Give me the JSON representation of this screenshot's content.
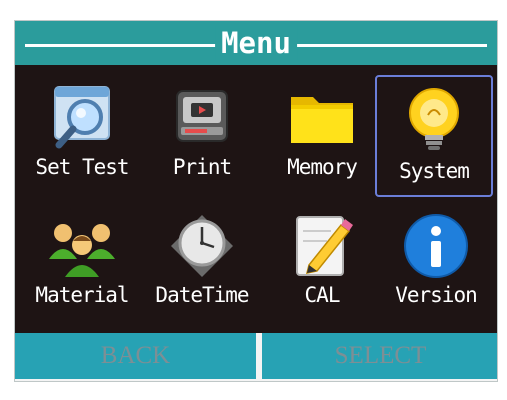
{
  "title": "Menu",
  "menu": {
    "items": [
      {
        "label": "Set Test",
        "icon": "magnifier-icon"
      },
      {
        "label": "Print",
        "icon": "printer-icon"
      },
      {
        "label": "Memory",
        "icon": "folder-icon"
      },
      {
        "label": "System",
        "icon": "lightbulb-icon",
        "selected": true
      },
      {
        "label": "Material",
        "icon": "users-icon"
      },
      {
        "label": "DateTime",
        "icon": "clock-icon"
      },
      {
        "label": "CAL",
        "icon": "pencil-note-icon"
      },
      {
        "label": "Version",
        "icon": "info-icon"
      }
    ]
  },
  "footer": {
    "back_label": "BACK",
    "select_label": "SELECT"
  },
  "colors": {
    "title_bar": "#2b9c9c",
    "screen_background": "#1e1414",
    "button_background": "#27a2b4",
    "selection_border": "#6b7ed8"
  }
}
